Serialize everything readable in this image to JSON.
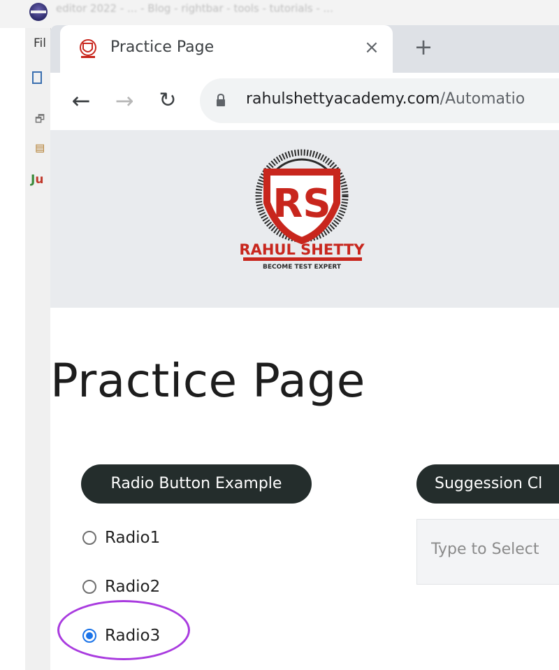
{
  "ide": {
    "title_text": "editor 2022 - ... - Blog - rightbar - tools - tutorials - ...",
    "menu_label": "Fil",
    "junit_label": "Ju"
  },
  "browser": {
    "tab": {
      "title": "Practice Page",
      "close_glyph": "×",
      "favicon": "rs-logo-icon"
    },
    "new_tab_glyph": "+",
    "nav": {
      "back_glyph": "←",
      "forward_glyph": "→",
      "reload_glyph": "↻"
    },
    "address": {
      "domain": "rahulshettyacademy.com",
      "path": "/Automatio"
    }
  },
  "page": {
    "logo": {
      "brand": "RAHUL SHETTY",
      "tagline": "BECOME TEST EXPERT",
      "monogram": "RS"
    },
    "title": "Practice Page",
    "radio_section": {
      "heading": "Radio Button Example",
      "options": [
        {
          "label": "Radio1",
          "checked": false
        },
        {
          "label": "Radio2",
          "checked": false
        },
        {
          "label": "Radio3",
          "checked": true
        }
      ]
    },
    "suggestion_section": {
      "heading": "Suggession Cl",
      "input_placeholder": "Type to Select"
    }
  },
  "colors": {
    "pill_bg": "#242d2c",
    "radio_checked": "#1a73e8",
    "highlight_ring": "#a93bdf",
    "logo_red": "#c8261d",
    "header_band": "#e9ebee"
  }
}
